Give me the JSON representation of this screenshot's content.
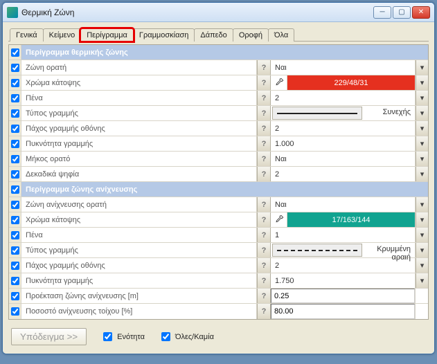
{
  "window": {
    "title": "Θερμική Ζώνη"
  },
  "tabs": [
    "Γενικά",
    "Κείμενο",
    "Περίγραμμα",
    "Γραμμοσκίαση",
    "Δάπεδο",
    "Οροφή",
    "Όλα"
  ],
  "active_tab": 2,
  "sections": [
    {
      "title": "Περίγραμμα θερμικής ζώνης",
      "rows": [
        {
          "label": "Ζώνη ορατή",
          "type": "plain",
          "value": "Ναι",
          "dd": true
        },
        {
          "label": "Χρώμα κάτοψης",
          "type": "color",
          "value": "229/48/31",
          "color": "#e5301f",
          "dd": true
        },
        {
          "label": "Πένα",
          "type": "plain",
          "value": "2",
          "dd": true
        },
        {
          "label": "Τύπος γραμμής",
          "type": "line",
          "line": "solid",
          "value": "Συνεχής",
          "dd": true
        },
        {
          "label": "Πάχος γραμμής οθόνης",
          "type": "plain",
          "value": "2",
          "dd": true
        },
        {
          "label": "Πυκνότητα γραμμής",
          "type": "plain",
          "value": "1.000",
          "dd": true
        },
        {
          "label": "Μήκος ορατό",
          "type": "plain",
          "value": "Ναι",
          "dd": true
        },
        {
          "label": "Δεκαδικά ψηφία",
          "type": "plain",
          "value": "2",
          "dd": true
        }
      ]
    },
    {
      "title": "Περίγραμμα ζώνης ανίχνευσης",
      "rows": [
        {
          "label": "Ζώνη ανίχνευσης ορατή",
          "type": "plain",
          "value": "Ναι",
          "dd": true
        },
        {
          "label": "Χρώμα κάτοψης",
          "type": "color",
          "value": "17/163/144",
          "color": "#11a390",
          "dd": true
        },
        {
          "label": "Πένα",
          "type": "plain",
          "value": "1",
          "dd": true
        },
        {
          "label": "Τύπος γραμμής",
          "type": "line",
          "line": "dashed",
          "value": "Κρυμμένη αραιή",
          "dd": true
        },
        {
          "label": "Πάχος γραμμής οθόνης",
          "type": "plain",
          "value": "2",
          "dd": true
        },
        {
          "label": "Πυκνότητα γραμμής",
          "type": "plain",
          "value": "1.750",
          "dd": true
        },
        {
          "label": "Προέκταση ζώνης ανίχνευσης [m]",
          "type": "edit",
          "value": "0.25",
          "dd": false
        },
        {
          "label": "Ποσοστό ανίχνευσης τοίχου [%]",
          "type": "edit",
          "value": "80.00",
          "dd": false
        }
      ]
    }
  ],
  "footer": {
    "sample_btn": "Υπόδειγμα >>",
    "chk1": "Ενότητα",
    "chk2": "Όλες/Καμία"
  }
}
